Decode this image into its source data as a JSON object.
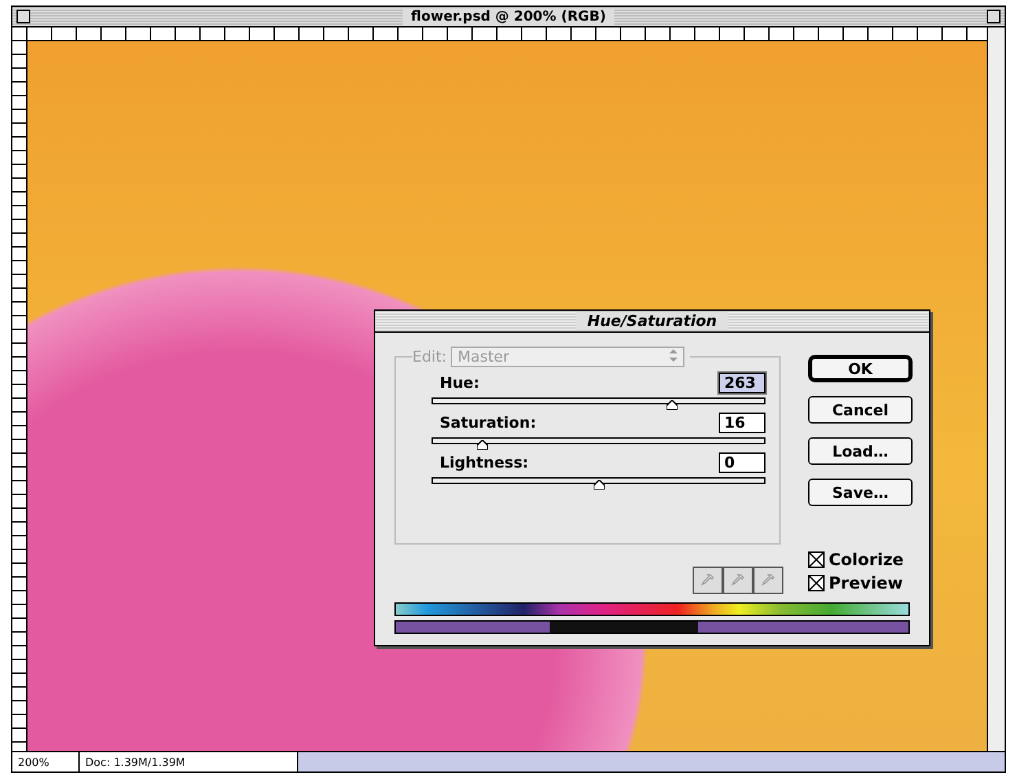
{
  "window": {
    "title": "flower.psd @ 200% (RGB)"
  },
  "dialog": {
    "title": "Hue/Saturation",
    "edit": {
      "label": "Edit:",
      "value": "Master",
      "disabled": true
    },
    "sliders": [
      {
        "label": "Hue:",
        "value": "263",
        "level": 0.72,
        "focused": true
      },
      {
        "label": "Saturation:",
        "value": "16",
        "level": 0.15,
        "focused": false
      },
      {
        "label": "Lightness:",
        "value": "0",
        "level": 0.5,
        "focused": false
      }
    ],
    "buttons": [
      {
        "label": "OK",
        "default": true
      },
      {
        "label": "Cancel",
        "default": false
      },
      {
        "label": "Load…",
        "default": false
      },
      {
        "label": "Save…",
        "default": false
      }
    ],
    "checkboxes": [
      {
        "label": "Colorize",
        "checked": true
      },
      {
        "label": "Preview",
        "checked": true
      }
    ]
  },
  "status_bar": {
    "zoom": "200%",
    "doc": "Doc: 1.39M/1.39M"
  }
}
